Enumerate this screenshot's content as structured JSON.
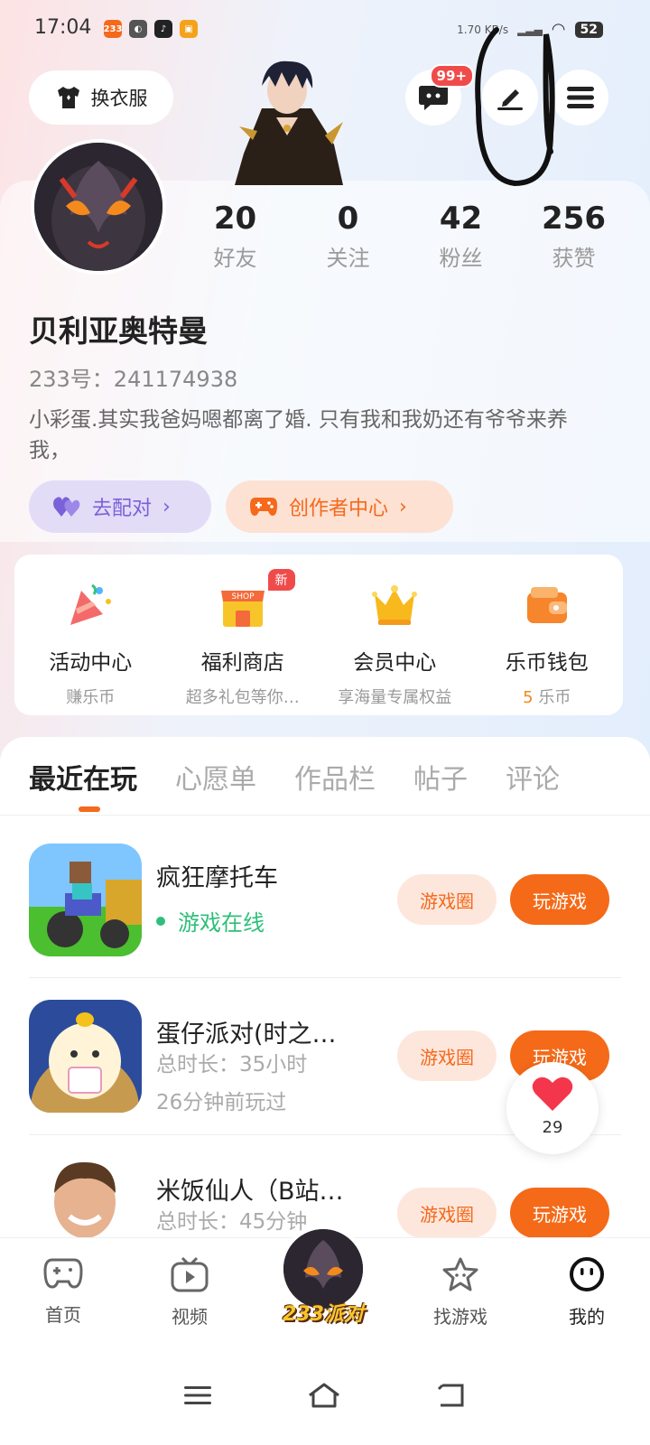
{
  "status_bar": {
    "time": "17:04",
    "net_speed": "1.70 KB/s",
    "battery": "52"
  },
  "header": {
    "outfit_label": "换衣服",
    "message_badge": "99+"
  },
  "profile": {
    "stats": [
      {
        "num": "20",
        "label": "好友"
      },
      {
        "num": "0",
        "label": "关注"
      },
      {
        "num": "42",
        "label": "粉丝"
      },
      {
        "num": "256",
        "label": "获赞"
      }
    ],
    "name": "贝利亚奥特曼",
    "id_text": "233号：241174938",
    "bio": "小彩蛋.其实我爸妈嗯都离了婚. 只有我和我奶还有爷爷来养我，",
    "match_label": "去配对",
    "creator_label": "创作者中心"
  },
  "menu": [
    {
      "title": "活动中心",
      "sub": "赚乐币"
    },
    {
      "title": "福利商店",
      "sub": "超多礼包等你…",
      "badge": "新"
    },
    {
      "title": "会员中心",
      "sub": "享海量专属权益"
    },
    {
      "title": "乐币钱包",
      "sub_num": "5",
      "sub_unit": "乐币"
    }
  ],
  "tabs": [
    "最近在玩",
    "心愿单",
    "作品栏",
    "帖子",
    "评论"
  ],
  "games": [
    {
      "title": "疯狂摩托车",
      "online": "游戏在线",
      "circle": "游戏圈",
      "play": "玩游戏"
    },
    {
      "title": "蛋仔派对(时之…",
      "duration": "总时长：35小时",
      "last": "26分钟前玩过",
      "circle": "游戏圈",
      "play": "玩游戏"
    },
    {
      "title": "米饭仙人（B站…",
      "duration": "总时长：45分钟",
      "circle": "游戏圈",
      "play": "玩游戏"
    }
  ],
  "like_float": {
    "count": "29"
  },
  "bottom_nav": {
    "home": "首页",
    "video": "视频",
    "center": "233派对",
    "find": "找游戏",
    "mine": "我的"
  }
}
